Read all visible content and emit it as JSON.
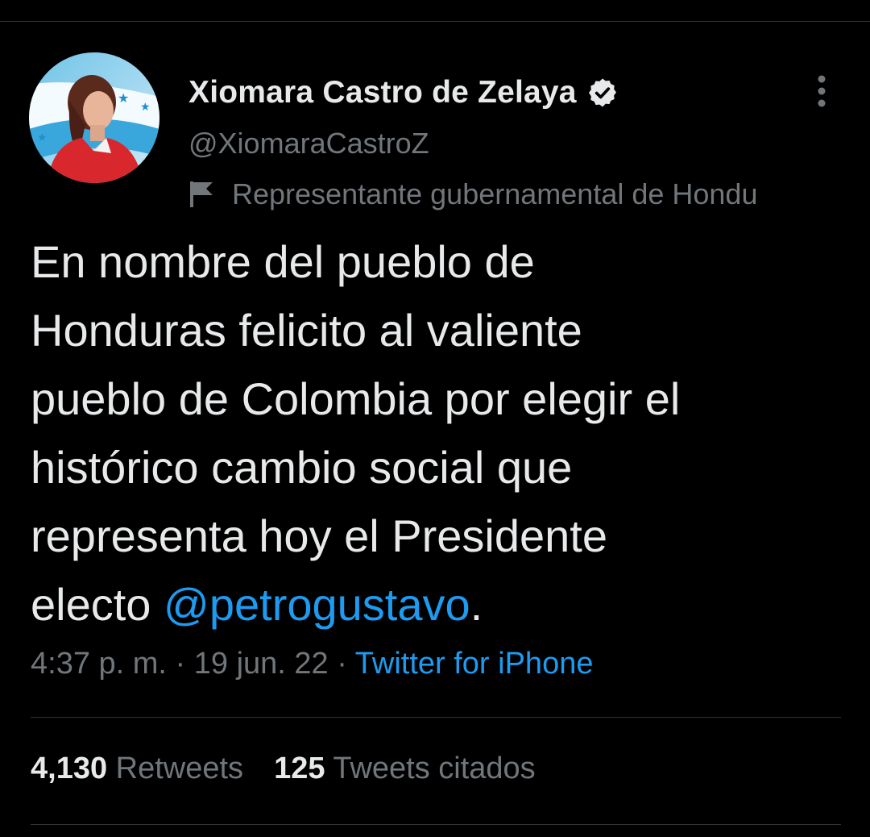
{
  "author": {
    "display_name": "Xiomara Castro de Zelaya",
    "handle": "@XiomaraCastroZ",
    "label": "Representante gubernamental de Hondu",
    "verified": true
  },
  "tweet": {
    "lines": [
      "En nombre del pueblo de",
      "Honduras felicito al valiente",
      "pueblo de Colombia por elegir el",
      "histórico cambio social que",
      "representa hoy el Presidente"
    ],
    "last_line_prefix": "electo ",
    "mention": "@petrogustavo",
    "last_line_suffix": "."
  },
  "meta": {
    "time": "4:37 p. m.",
    "separator": " · ",
    "date": "19 jun. 22",
    "source": "Twitter for iPhone"
  },
  "stats": {
    "retweets_count": "4,130",
    "retweets_label": "Retweets",
    "quotes_count": "125",
    "quotes_label": "Tweets citados"
  },
  "icons": {
    "verified": "verified-badge-icon",
    "flag": "flag-icon",
    "more": "more-vertical-icon"
  },
  "colors": {
    "background": "#000000",
    "text": "#e7e9ea",
    "secondary": "#71767b",
    "link": "#1d9bf0",
    "divider": "#2f3336"
  }
}
